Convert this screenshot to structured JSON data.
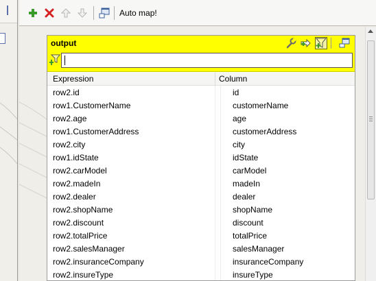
{
  "toolbar": {
    "add_icon": "plus-icon",
    "remove_icon": "delete-x-icon",
    "move_up_icon": "arrow-up-icon",
    "move_down_icon": "arrow-down-icon",
    "auto_map_icon": "auto-map-icon",
    "auto_map_label": "Auto map!"
  },
  "table": {
    "title": "output",
    "icons": [
      "wrench-icon",
      "arrow-plus-icon",
      "filter-add-icon",
      "window-icon"
    ],
    "filter_value": "",
    "columns": {
      "expression": "Expression",
      "column": "Column"
    },
    "rows": [
      {
        "expression": "row2.id",
        "column": "id"
      },
      {
        "expression": "row1.CustomerName",
        "column": "customerName"
      },
      {
        "expression": "row2.age",
        "column": "age"
      },
      {
        "expression": "row1.CustomerAddress",
        "column": "customerAddress"
      },
      {
        "expression": "row2.city",
        "column": "city"
      },
      {
        "expression": "row1.idState",
        "column": "idState"
      },
      {
        "expression": "row2.carModel",
        "column": "carModel"
      },
      {
        "expression": "row2.madeIn",
        "column": "madeIn"
      },
      {
        "expression": "row2.dealer",
        "column": "dealer"
      },
      {
        "expression": "row2.shopName",
        "column": "shopName"
      },
      {
        "expression": "row2.discount",
        "column": "discount"
      },
      {
        "expression": "row2.totalPrice",
        "column": "totalPrice"
      },
      {
        "expression": "row2.salesManager",
        "column": "salesManager"
      },
      {
        "expression": "row2.insuranceCompany",
        "column": "insuranceCompany"
      },
      {
        "expression": "row2.insureType",
        "column": "insureType"
      }
    ]
  },
  "colors": {
    "header_yellow": "#ffff00",
    "add_green": "#3a9a2a",
    "remove_red": "#d42020"
  }
}
